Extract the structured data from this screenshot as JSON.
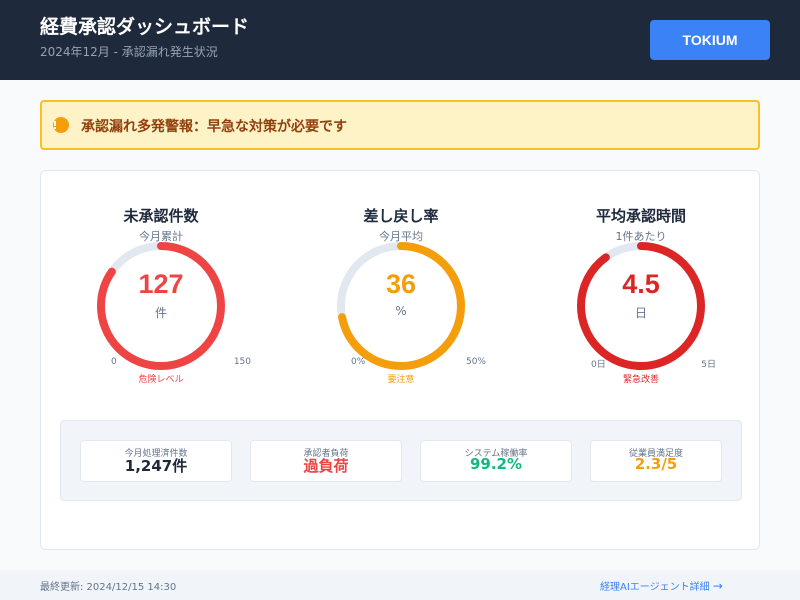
{
  "header": {
    "title": "経費承認ダッシュボード",
    "subtitle": "2024年12月 - 承認漏れ発生状況",
    "brand_button": "TOKIUM"
  },
  "alert": {
    "text": "承認漏れ多発警報：早急な対策が必要です",
    "icon": "warning-circle-icon",
    "color": "#f59e0b"
  },
  "gauges": [
    {
      "title": "未承認件数",
      "subtitle": "今月累計",
      "value": "127",
      "unit": "件",
      "min": "0",
      "max": "150",
      "status": "危険レベル",
      "numeric_value": 127,
      "range": [
        0,
        150
      ],
      "color": "#ef4444"
    },
    {
      "title": "差し戻し率",
      "subtitle": "今月平均",
      "value": "36",
      "unit": "%",
      "min": "0%",
      "max": "50%",
      "status": "要注意",
      "numeric_value": 36,
      "range": [
        0,
        50
      ],
      "color": "#f59e0b"
    },
    {
      "title": "平均承認時間",
      "subtitle": "1件あたり",
      "value": "4.5",
      "unit": "日",
      "min": "0日",
      "max": "5日",
      "status": "緊急改善",
      "numeric_value": 4.5,
      "range": [
        0,
        5
      ],
      "color": "#dc2626"
    }
  ],
  "stats": [
    {
      "label": "今月処理済件数",
      "value": "1,247件",
      "color": "#1e293b"
    },
    {
      "label": "承認者負荷",
      "value": "過負荷",
      "color": "#ef4444"
    },
    {
      "label": "システム稼働率",
      "value": "99.2%",
      "color": "#10b981"
    },
    {
      "label": "従業員満足度",
      "value": "2.3/5",
      "color": "#f59e0b"
    }
  ],
  "footer": {
    "last_updated": "最終更新: 2024/12/15 14:30",
    "link_text": "経理AIエージェント詳細",
    "link_arrow": "→"
  },
  "colors": {
    "header_bg": "#1e293b",
    "accent": "#3b82f6",
    "track": "#e2e8f0"
  }
}
